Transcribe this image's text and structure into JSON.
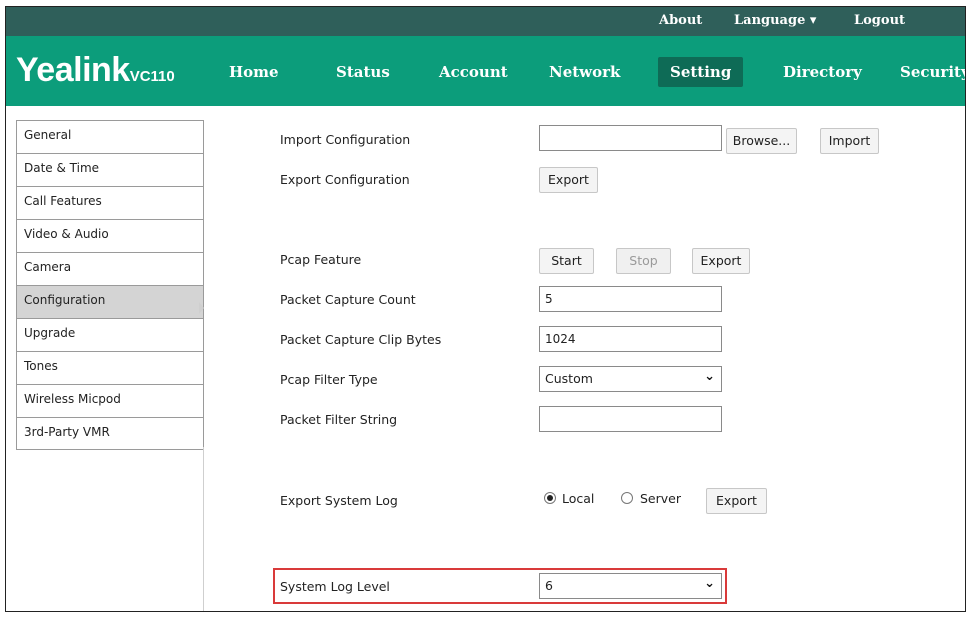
{
  "topbar": {
    "about": "About",
    "language": "Language ▾",
    "logout": "Logout"
  },
  "brand": {
    "name": "Yealink",
    "model": "VC110"
  },
  "nav": {
    "tabs": [
      "Home",
      "Status",
      "Account",
      "Network",
      "Setting",
      "Directory",
      "Security"
    ],
    "active": "Setting"
  },
  "sidebar": {
    "items": [
      "General",
      "Date & Time",
      "Call Features",
      "Video & Audio",
      "Camera",
      "Configuration",
      "Upgrade",
      "Tones",
      "Wireless Micpod",
      "3rd-Party VMR"
    ],
    "active": "Configuration"
  },
  "form": {
    "import_config": {
      "label": "Import Configuration",
      "value": "",
      "browse": "Browse...",
      "import": "Import"
    },
    "export_config": {
      "label": "Export Configuration",
      "export": "Export"
    },
    "pcap": {
      "label": "Pcap Feature",
      "start": "Start",
      "stop": "Stop",
      "export": "Export"
    },
    "capture_count": {
      "label": "Packet Capture Count",
      "value": "5"
    },
    "clip_bytes": {
      "label": "Packet Capture Clip Bytes",
      "value": "1024"
    },
    "filter_type": {
      "label": "Pcap Filter Type",
      "value": "Custom"
    },
    "filter_string": {
      "label": "Packet Filter String",
      "value": ""
    },
    "export_log": {
      "label": "Export System Log",
      "local": "Local",
      "server": "Server",
      "selected": "Local",
      "export": "Export"
    },
    "log_level": {
      "label": "System Log Level",
      "value": "6"
    }
  },
  "colors": {
    "topbar": "#2f5f5a",
    "nav": "#0c9d7b",
    "nav_active": "#0e6b56",
    "highlight": "#d93a3a"
  }
}
